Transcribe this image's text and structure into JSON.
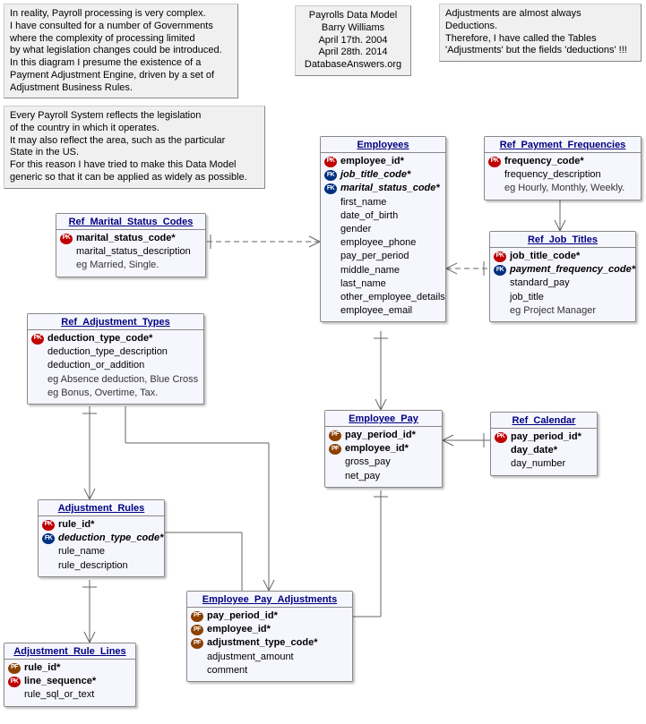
{
  "notes": {
    "topLeft": {
      "l1": "In reality, Payroll processing is very complex.",
      "l2": "I have consulted for a number of Governments",
      "l3": "where the complexity of processing limited",
      "l4": "by what legislation changes could be introduced.",
      "l5": "In this diagram I presume the existence of a",
      "l6": "Payment Adjustment Engine, driven by a set of",
      "l7": "Adjustment Business Rules."
    },
    "header": {
      "l1": "Payrolls Data Model",
      "l2": "Barry Williams",
      "l3": "April 17th. 2004",
      "l4": "April 28th. 2014",
      "l5": "DatabaseAnswers.org"
    },
    "topRight": {
      "l1": "Adjustments are almost always Deductions.",
      "l2": "Therefore, I have called the Tables",
      "l3": "'Adjustments' but the fields 'deductions' !!!"
    },
    "legislation": {
      "l1": "Every Payroll System reflects the legislation",
      "l2": "of the country in which it operates.",
      "l3": "It may also reflect the area, such as the particular",
      "l4": "State in the US.",
      "l5": "For this reason I have tried to make this Data Model",
      "l6": "generic so that it can be applied as widely as possible."
    }
  },
  "entities": {
    "employees": {
      "title": "Employees",
      "attrs": [
        {
          "k": "pk",
          "n": "employee_id*",
          "req": true
        },
        {
          "k": "fk",
          "n": "job_title_code*",
          "req": true,
          "it": true
        },
        {
          "k": "fk",
          "n": "marital_status_code*",
          "req": true,
          "it": true
        },
        {
          "k": "",
          "n": "first_name"
        },
        {
          "k": "",
          "n": "date_of_birth"
        },
        {
          "k": "",
          "n": "gender"
        },
        {
          "k": "",
          "n": "employee_phone"
        },
        {
          "k": "",
          "n": "pay_per_period"
        },
        {
          "k": "",
          "n": "middle_name"
        },
        {
          "k": "",
          "n": "last_name"
        },
        {
          "k": "",
          "n": "other_employee_details"
        },
        {
          "k": "",
          "n": "employee_email"
        }
      ]
    },
    "refPaymentFreq": {
      "title": "Ref_Payment_Frequencies",
      "attrs": [
        {
          "k": "pk",
          "n": "frequency_code*",
          "req": true
        },
        {
          "k": "",
          "n": "frequency_description"
        },
        {
          "k": "",
          "n": "eg Hourly, Monthly, Weekly.",
          "eg": true
        }
      ]
    },
    "refJobTitles": {
      "title": "Ref_Job_Titles",
      "attrs": [
        {
          "k": "pk",
          "n": "job_title_code*",
          "req": true
        },
        {
          "k": "fk",
          "n": "payment_frequency_code*",
          "req": true,
          "it": true
        },
        {
          "k": "",
          "n": "standard_pay"
        },
        {
          "k": "",
          "n": "job_title"
        },
        {
          "k": "",
          "n": "eg Project Manager",
          "eg": true
        }
      ]
    },
    "refMarital": {
      "title": "Ref_Marital_Status_Codes",
      "attrs": [
        {
          "k": "pk",
          "n": "marital_status_code*",
          "req": true
        },
        {
          "k": "",
          "n": "marital_status_description"
        },
        {
          "k": "",
          "n": "eg Married, Single.",
          "eg": true
        }
      ]
    },
    "refAdjTypes": {
      "title": "Ref_Adjustment_Types",
      "attrs": [
        {
          "k": "pk",
          "n": "deduction_type_code*",
          "req": true
        },
        {
          "k": "",
          "n": "deduction_type_description"
        },
        {
          "k": "",
          "n": "deduction_or_addition"
        },
        {
          "k": "",
          "n": "eg Absence deduction, Blue Cross",
          "eg": true
        },
        {
          "k": "",
          "n": "eg Bonus, Overtime, Tax.",
          "eg": true
        }
      ]
    },
    "employeePay": {
      "title": "Employee_Pay",
      "attrs": [
        {
          "k": "pf",
          "n": "pay_period_id*",
          "req": true
        },
        {
          "k": "pf",
          "n": "employee_id*",
          "req": true
        },
        {
          "k": "",
          "n": "gross_pay"
        },
        {
          "k": "",
          "n": "net_pay"
        }
      ]
    },
    "refCalendar": {
      "title": "Ref_Calendar",
      "attrs": [
        {
          "k": "pk",
          "n": "pay_period_id*",
          "req": true
        },
        {
          "k": "",
          "n": "day_date*",
          "req": true
        },
        {
          "k": "",
          "n": "day_number"
        }
      ]
    },
    "adjRules": {
      "title": "Adjustment_Rules",
      "attrs": [
        {
          "k": "pk",
          "n": "rule_id*",
          "req": true
        },
        {
          "k": "fk",
          "n": "deduction_type_code*",
          "req": true,
          "it": true
        },
        {
          "k": "",
          "n": "rule_name"
        },
        {
          "k": "",
          "n": "rule_description"
        }
      ]
    },
    "adjRuleLines": {
      "title": "Adjustment_Rule_Lines",
      "attrs": [
        {
          "k": "pf",
          "n": "rule_id*",
          "req": true
        },
        {
          "k": "pk",
          "n": "line_sequence*",
          "req": true
        },
        {
          "k": "",
          "n": "rule_sql_or_text"
        }
      ]
    },
    "empPayAdj": {
      "title": "Employee_Pay_Adjustments",
      "attrs": [
        {
          "k": "pf",
          "n": "pay_period_id*",
          "req": true
        },
        {
          "k": "pf",
          "n": "employee_id*",
          "req": true
        },
        {
          "k": "pf",
          "n": "adjustment_type_code*",
          "req": true
        },
        {
          "k": "",
          "n": "adjustment_amount"
        },
        {
          "k": "",
          "n": "comment"
        }
      ]
    }
  }
}
